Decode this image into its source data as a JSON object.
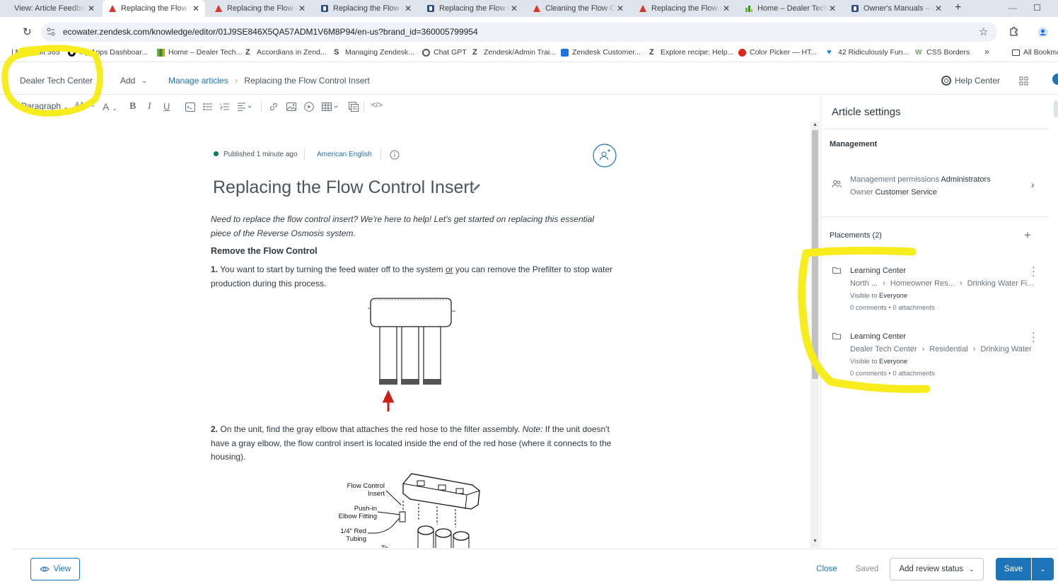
{
  "browser": {
    "tabs": [
      {
        "label": "View: Article Feedback",
        "icon": "zendesk-icon"
      },
      {
        "label": "Replacing the Flow Control",
        "icon": "red-triangle-icon",
        "active": true
      },
      {
        "label": "Replacing the Flow Control",
        "icon": "red-triangle-icon"
      },
      {
        "label": "Replacing the Flow Control",
        "icon": "blue-square-icon"
      },
      {
        "label": "Replacing the Flow Control",
        "icon": "blue-square-icon"
      },
      {
        "label": "Cleaning the Flow Control",
        "icon": "red-triangle-icon"
      },
      {
        "label": "Replacing the Flow Control",
        "icon": "red-triangle-icon"
      },
      {
        "label": "Home – Dealer Tech",
        "icon": "green-bar-icon"
      },
      {
        "label": "Owner's Manuals – N",
        "icon": "blue-square-icon"
      }
    ],
    "url": "ecowater.zendesk.com/knowledge/editor/01J9SE846X5QA57ADM1V6M8P94/en-us?brand_id=360005799954",
    "bookmarks": [
      {
        "label": "| Microsoft 365"
      },
      {
        "label": "My Apps Dashboar..."
      },
      {
        "label": "Home – Dealer Tech..."
      },
      {
        "label": "Accordians in Zend..."
      },
      {
        "label": "Managing Zendesk..."
      },
      {
        "label": "Chat GPT"
      },
      {
        "label": "Zendesk/Admin Trai..."
      },
      {
        "label": "Zendesk Customer..."
      },
      {
        "label": "Explore recipe: Help..."
      },
      {
        "label": "Color Picker — HT..."
      },
      {
        "label": "42 Ridiculously Fun..."
      },
      {
        "label": "CSS Borders"
      },
      {
        "label": "All Bookmarks"
      }
    ]
  },
  "header": {
    "brand": "Dealer Tech Center",
    "add": "Add",
    "breadcrumb_manage": "Manage articles",
    "breadcrumb_current": "Replacing the Flow Control Insert",
    "help_center": "Help Center"
  },
  "toolbar": {
    "format": "Paragraph",
    "size_label": "AA"
  },
  "article": {
    "status": "Published 1 minute ago",
    "language": "American English",
    "title": "Replacing the Flow Control Insert",
    "intro": "Need to replace the flow control insert? We're here to help! Let's get started on replacing this essential piece of the Reverse Osmosis system.",
    "heading": "Remove the Flow Control",
    "step1_num": "1.",
    "step1_a": "You want to start by turning the feed water off to the system",
    "step1_or": "or",
    "step1_b": "you can remove the Prefilter to stop water production during this process.",
    "step2_num": "2.",
    "step2_a": "On the unit, find the gray elbow that attaches the red hose to the filter assembly.",
    "step2_note": "Note:",
    "step2_b": "If the unit doesn't have a gray elbow, the flow control insert is located inside the end of the red hose (where it connects to the housing).",
    "diagram_labels": {
      "flow_control": "Flow Control",
      "insert": "Insert",
      "push_in": "Push-in",
      "elbow": "Elbow Fitting",
      "red": "1/4\" Red",
      "tubing": "Tubing",
      "to": "To"
    }
  },
  "settings": {
    "title": "Article settings",
    "management": "Management",
    "perm_label": "Management permissions",
    "perm_value": "Administrators",
    "owner_label": "Owner",
    "owner_value": "Customer Service",
    "placements": "Placements (2)",
    "items": [
      {
        "title": "Learning Center",
        "path": [
          "North ...",
          "Homeowner Res...",
          "Drinking Water Fi..."
        ],
        "visible_label": "Visible to",
        "visible_value": "Everyone",
        "counts": "0 comments • 0 attachments"
      },
      {
        "title": "Learning Center",
        "path": [
          "Dealer Tech Center",
          "Residential",
          "Drinking Water"
        ],
        "visible_label": "Visible to",
        "visible_value": "Everyone",
        "counts": "0 comments • 0 attachments"
      }
    ]
  },
  "footer": {
    "view": "View",
    "close": "Close",
    "saved": "Saved",
    "review": "Add review status",
    "save": "Save"
  },
  "colors": {
    "accent": "#1f73b7",
    "published": "#038153",
    "highlight": "#f7ec1d",
    "arrow": "#cc1f1a"
  }
}
